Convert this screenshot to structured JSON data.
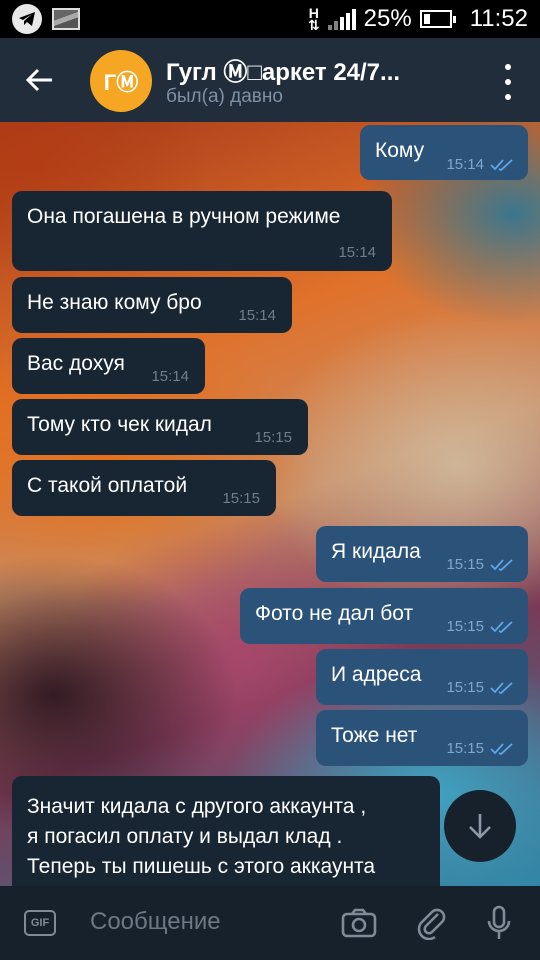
{
  "status_bar": {
    "battery": "25%",
    "battery_level": 0.25,
    "time": "11:52",
    "network": "H"
  },
  "header": {
    "avatar_text": "ГⓂ",
    "title": "Гугл Ⓜ□аркет 24/7...",
    "subtitle": "был(а) давно"
  },
  "messages": [
    {
      "dir": "out",
      "text": "Кому",
      "time": "15:14"
    },
    {
      "dir": "in",
      "text": "Она погашена в ручном режиме",
      "time": "15:14"
    },
    {
      "dir": "in",
      "text": "Не знаю кому бро",
      "time": "15:14"
    },
    {
      "dir": "in",
      "text": "Вас дохуя",
      "time": "15:14"
    },
    {
      "dir": "in",
      "text": "Тому кто чек кидал",
      "time": "15:15"
    },
    {
      "dir": "in",
      "text": "С такой оплатой",
      "time": "15:15"
    },
    {
      "dir": "out",
      "text": "Я кидала",
      "time": "15:15"
    },
    {
      "dir": "out",
      "text": "Фото не дал бот",
      "time": "15:15"
    },
    {
      "dir": "out",
      "text": "И адреса",
      "time": "15:15"
    },
    {
      "dir": "out",
      "text": "Тоже нет",
      "time": "15:15"
    },
    {
      "dir": "in",
      "lines": [
        "Значит кидала с другого аккаунта ,",
        "я погасил оплату и выдал клад .",
        "Теперь ты пишешь с этого аккаунта"
      ]
    }
  ],
  "input": {
    "gif_label": "GIF",
    "placeholder": "Сообщение"
  },
  "colors": {
    "header_bg": "#212d3b",
    "incoming_bubble": "#182533",
    "outgoing_bubble": "#2b5278",
    "avatar": "#f5a623",
    "input_bg": "#17212b"
  },
  "icons": [
    "telegram-icon",
    "image-icon",
    "back-arrow-icon",
    "more-vert-icon",
    "double-check-icon",
    "scroll-down-icon",
    "gif-icon",
    "camera-icon",
    "attach-icon",
    "mic-icon"
  ]
}
